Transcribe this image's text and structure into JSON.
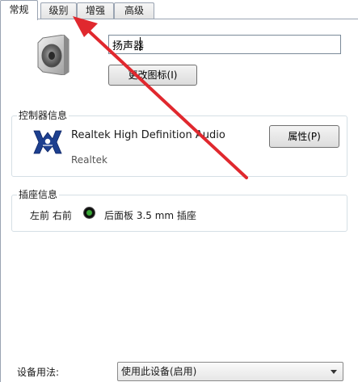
{
  "tabs": [
    {
      "label": "常规",
      "active": true
    },
    {
      "label": "级别",
      "active": false
    },
    {
      "label": "增强",
      "active": false
    },
    {
      "label": "高级",
      "active": false
    }
  ],
  "general": {
    "device_icon": "speaker-icon",
    "name_value": "扬声器",
    "change_icon_label": "更改图标(I)"
  },
  "controller": {
    "legend": "控制器信息",
    "logo_icon": "realtek-logo-icon",
    "device_name": "Realtek High Definition Audio",
    "vendor": "Realtek",
    "properties_label": "属性(P)"
  },
  "jack": {
    "legend": "插座信息",
    "position": "左前 右前",
    "color_icon": "green-jack-icon",
    "description": "后面板 3.5 mm 插座"
  },
  "usage": {
    "label": "设备用法:",
    "selected": "使用此设备(启用)"
  },
  "annotation": {
    "arrow_color": "#e0282e",
    "points_to": "tab-levels"
  }
}
